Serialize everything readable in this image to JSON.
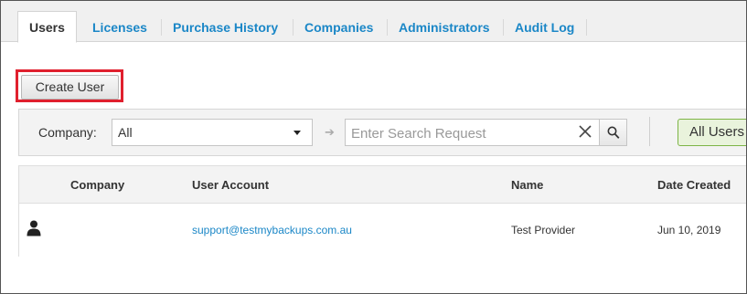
{
  "tabs": [
    {
      "label": "Users",
      "active": true
    },
    {
      "label": "Licenses",
      "active": false
    },
    {
      "label": "Purchase History",
      "active": false
    },
    {
      "label": "Companies",
      "active": false
    },
    {
      "label": "Administrators",
      "active": false
    },
    {
      "label": "Audit Log",
      "active": false
    }
  ],
  "toolbar": {
    "create_user_label": "Create User",
    "highlight_color": "#e0202e"
  },
  "filters": {
    "company_label": "Company:",
    "company_selected": "All",
    "search_placeholder": "Enter Search Request",
    "search_value": "",
    "all_users_label": "All Users"
  },
  "table": {
    "headers": [
      "Company",
      "User Account",
      "Name",
      "Date Created"
    ],
    "rows": [
      {
        "icon": "user-icon",
        "company": "",
        "user_account": "support@testmybackups.com.au",
        "name": "Test Provider",
        "date_created": "Jun 10, 2019"
      }
    ]
  },
  "colors": {
    "link": "#1b87c7",
    "accent_green": "#7db446",
    "header_bg": "#f3f3f3"
  }
}
